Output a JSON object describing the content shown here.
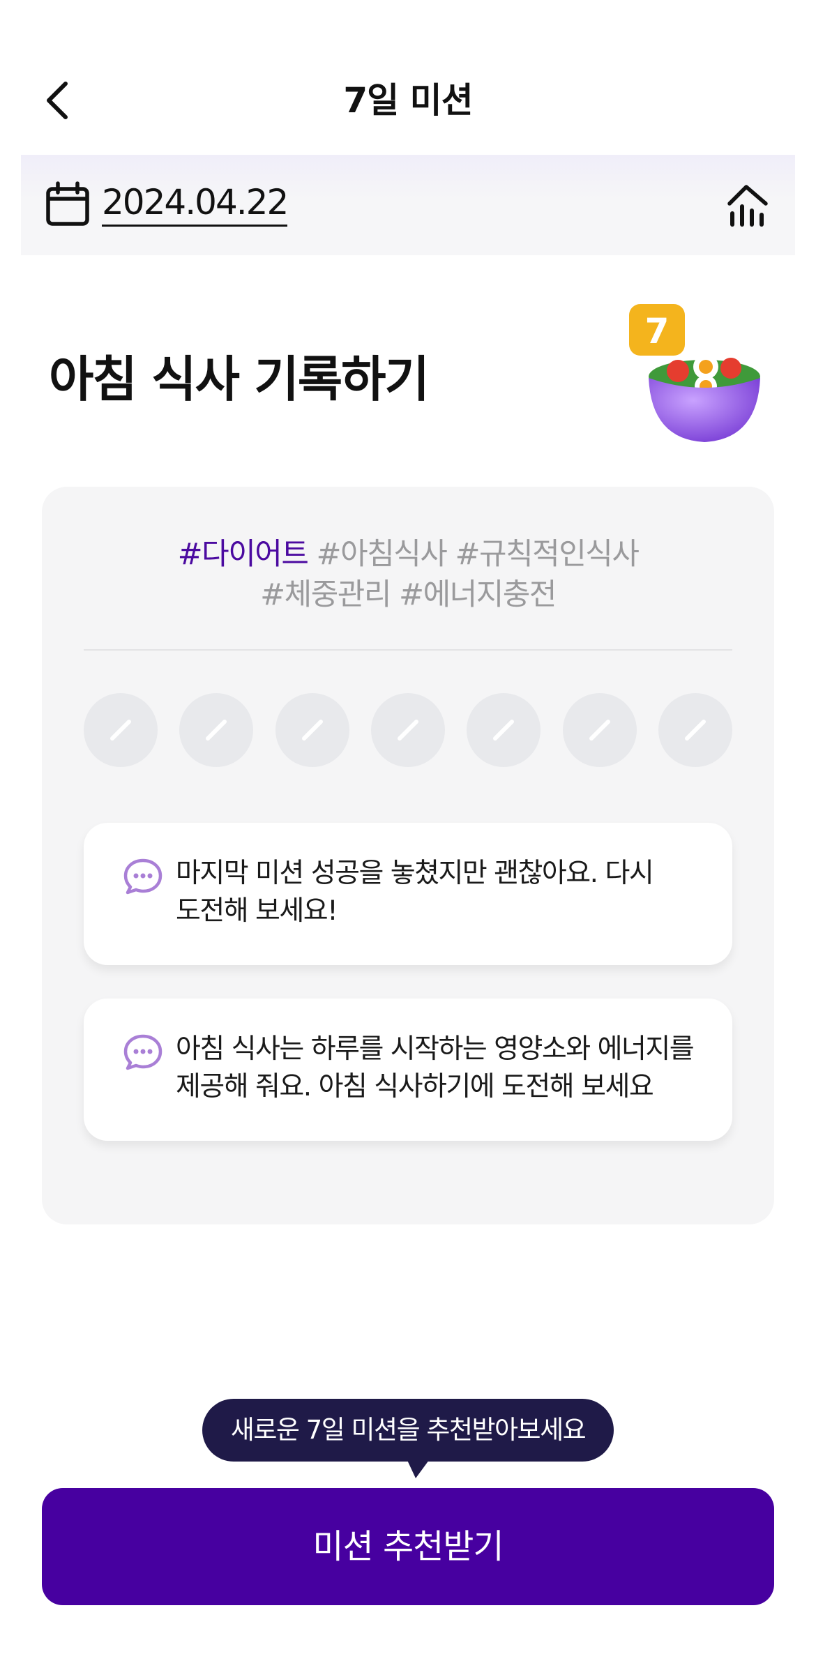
{
  "header": {
    "title": "7일 미션",
    "back_icon": "chevron-left-icon"
  },
  "date_bar": {
    "date": "2024.04.22",
    "calendar_icon": "calendar-icon",
    "stats_icon": "bar-chart-icon"
  },
  "mission": {
    "title": "아침 식사 기록하기",
    "illustration": "salad-bowl-icon",
    "badge": "7"
  },
  "tags": {
    "primary": "#다이어트",
    "line1_rest": " #아침식사 #규칙적인식사",
    "line2": "#체중관리 #에너지충전"
  },
  "days": {
    "count": 7,
    "icon": "pencil-icon"
  },
  "messages": [
    {
      "icon": "chat-bubble-icon",
      "text_line1": "마지막 미션 성공을 놓쳤지만 괜찮아요. 다시",
      "text_line2": "도전해 보세요!"
    },
    {
      "icon": "chat-bubble-icon",
      "text_line1": "아침 식사는 하루를 시작하는 영양소와 에너지를",
      "text_line2": "제공해 줘요. 아침 식사하기에 도전해 보세요"
    }
  ],
  "tooltip": {
    "text": "새로운 7일 미션을 추천받아보세요"
  },
  "cta": {
    "label": "미션 추천받기"
  },
  "colors": {
    "primary": "#4700a0",
    "tag_primary": "#4b0aa0",
    "tooltip_bg": "#1f1a48",
    "card_bg": "#f5f5f6",
    "chat_icon": "#a97fd6"
  }
}
